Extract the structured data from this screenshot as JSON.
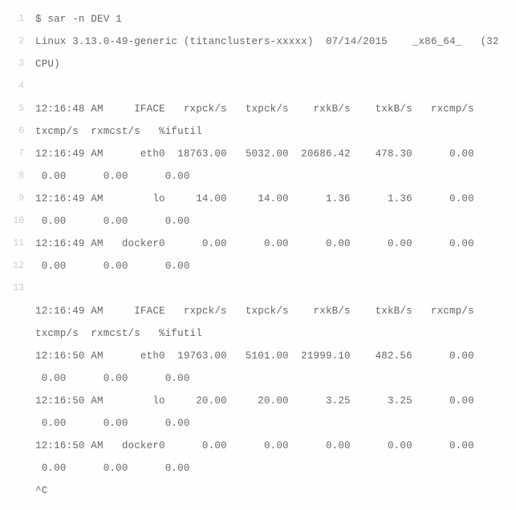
{
  "lines": [
    {
      "num": "1",
      "text": "$ sar -n DEV 1"
    },
    {
      "num": "2",
      "text": "Linux 3.13.0-49-generic (titanclusters-xxxxx)  07/14/2015    _x86_64_   (32"
    },
    {
      "num": "3",
      "text": "CPU)"
    },
    {
      "num": "4",
      "text": ""
    },
    {
      "num": "5",
      "text": "12:16:48 AM     IFACE   rxpck/s   txpck/s    rxkB/s    txkB/s   rxcmp/s  "
    },
    {
      "num": "6",
      "text": "txcmp/s  rxmcst/s   %ifutil"
    },
    {
      "num": "7",
      "text": "12:16:49 AM      eth0  18763.00   5032.00  20686.42    478.30      0.00    "
    },
    {
      "num": "8",
      "text": " 0.00      0.00      0.00"
    },
    {
      "num": "9",
      "text": "12:16:49 AM        lo     14.00     14.00      1.36      1.36      0.00    "
    },
    {
      "num": "10",
      "text": " 0.00      0.00      0.00"
    },
    {
      "num": "11",
      "text": "12:16:49 AM   docker0      0.00      0.00      0.00      0.00      0.00    "
    },
    {
      "num": "12",
      "text": " 0.00      0.00      0.00"
    },
    {
      "num": "13",
      "text": ""
    },
    {
      "num": "",
      "text": "12:16:49 AM     IFACE   rxpck/s   txpck/s    rxkB/s    txkB/s   rxcmp/s  "
    },
    {
      "num": "",
      "text": "txcmp/s  rxmcst/s   %ifutil"
    },
    {
      "num": "",
      "text": "12:16:50 AM      eth0  19763.00   5101.00  21999.10    482.56      0.00    "
    },
    {
      "num": "",
      "text": " 0.00      0.00      0.00"
    },
    {
      "num": "",
      "text": "12:16:50 AM        lo     20.00     20.00      3.25      3.25      0.00    "
    },
    {
      "num": "",
      "text": " 0.00      0.00      0.00"
    },
    {
      "num": "",
      "text": "12:16:50 AM   docker0      0.00      0.00      0.00      0.00      0.00    "
    },
    {
      "num": "",
      "text": " 0.00      0.00      0.00"
    },
    {
      "num": "",
      "text": "^C"
    }
  ]
}
